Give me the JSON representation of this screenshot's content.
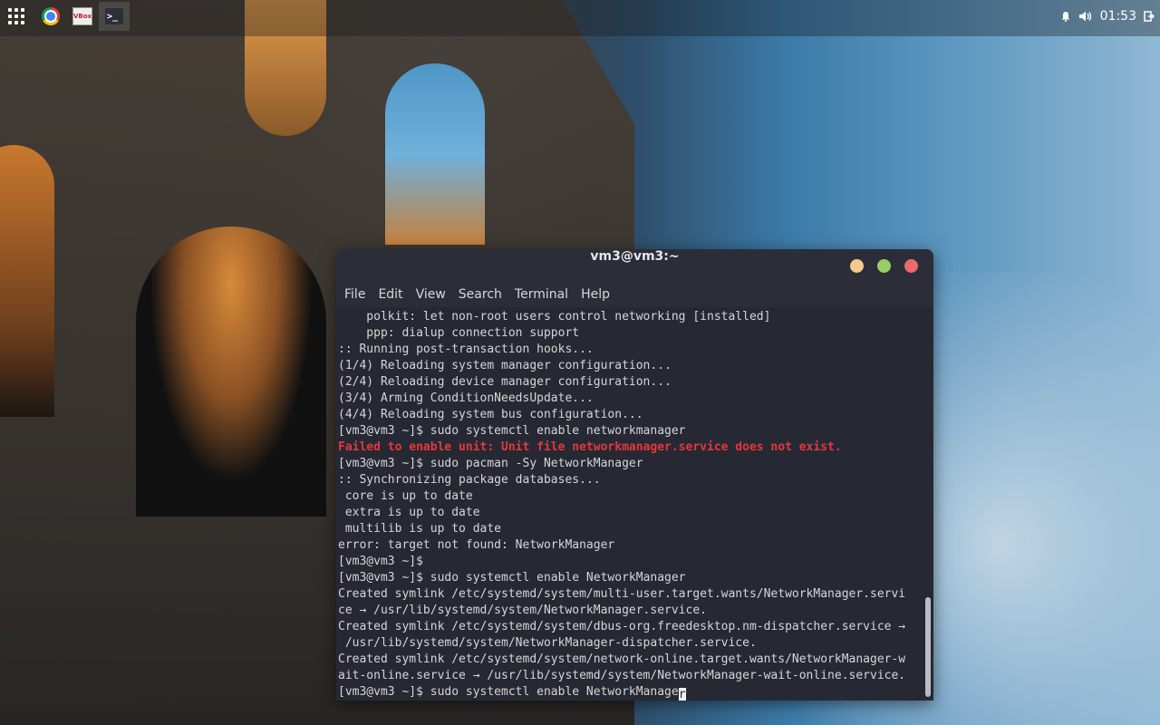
{
  "taskbar": {
    "apps": [
      {
        "name": "app-grid"
      },
      {
        "name": "google-chrome"
      },
      {
        "name": "virtualbox",
        "label": "VBox"
      },
      {
        "name": "terminal",
        "label": ">_"
      }
    ],
    "clock": "01:53"
  },
  "terminal": {
    "title": "vm3@vm3:~",
    "menu": [
      "File",
      "Edit",
      "View",
      "Search",
      "Terminal",
      "Help"
    ],
    "lines": [
      {
        "text": "    polkit: let non-root users control networking [installed]",
        "type": "normal"
      },
      {
        "text": "    ppp: dialup connection support",
        "type": "normal"
      },
      {
        "text": ":: Running post-transaction hooks...",
        "type": "normal"
      },
      {
        "text": "(1/4) Reloading system manager configuration...",
        "type": "normal"
      },
      {
        "text": "(2/4) Reloading device manager configuration...",
        "type": "normal"
      },
      {
        "text": "(3/4) Arming ConditionNeedsUpdate...",
        "type": "normal"
      },
      {
        "text": "(4/4) Reloading system bus configuration...",
        "type": "normal"
      },
      {
        "text": "[vm3@vm3 ~]$ sudo systemctl enable networkmanager",
        "type": "normal"
      },
      {
        "text": "Failed to enable unit: Unit file networkmanager.service does not exist.",
        "type": "err"
      },
      {
        "text": "[vm3@vm3 ~]$ sudo pacman -Sy NetworkManager",
        "type": "normal"
      },
      {
        "text": ":: Synchronizing package databases...",
        "type": "normal"
      },
      {
        "text": " core is up to date",
        "type": "normal"
      },
      {
        "text": " extra is up to date",
        "type": "normal"
      },
      {
        "text": " multilib is up to date",
        "type": "normal"
      },
      {
        "text": "error: target not found: NetworkManager",
        "type": "normal"
      },
      {
        "text": "[vm3@vm3 ~]$",
        "type": "normal"
      },
      {
        "text": "[vm3@vm3 ~]$ sudo systemctl enable NetworkManager",
        "type": "normal"
      },
      {
        "text": "Created symlink /etc/systemd/system/multi-user.target.wants/NetworkManager.servi",
        "type": "normal"
      },
      {
        "text": "ce → /usr/lib/systemd/system/NetworkManager.service.",
        "type": "normal"
      },
      {
        "text": "Created symlink /etc/systemd/system/dbus-org.freedesktop.nm-dispatcher.service →",
        "type": "normal"
      },
      {
        "text": " /usr/lib/systemd/system/NetworkManager-dispatcher.service.",
        "type": "normal"
      },
      {
        "text": "Created symlink /etc/systemd/system/network-online.target.wants/NetworkManager-w",
        "type": "normal"
      },
      {
        "text": "ait-online.service → /usr/lib/systemd/system/NetworkManager-wait-online.service.",
        "type": "normal"
      }
    ],
    "prompt_line": "[vm3@vm3 ~]$ sudo systemctl enable NetworkManage",
    "cursor_char": "r"
  },
  "colors": {
    "terminal_bg": "#262933",
    "error_text": "#e5383b",
    "btn_min": "#f3cb8a",
    "btn_max": "#99cc66",
    "btn_close": "#ec6a6a"
  }
}
